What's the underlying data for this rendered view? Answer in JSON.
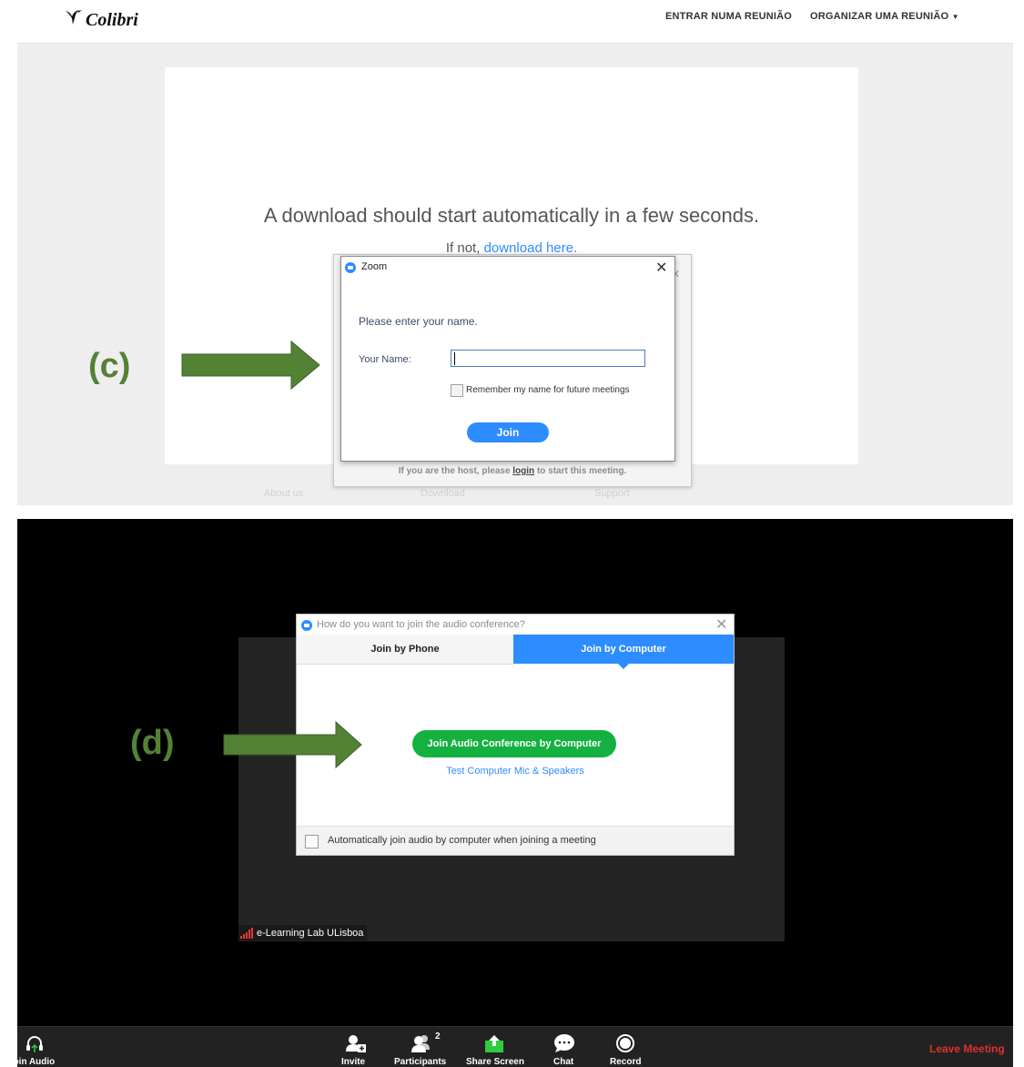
{
  "panel_c": {
    "brand": "Colibri",
    "nav": {
      "join": "ENTRAR NUMA REUNIÃO",
      "host": "ORGANIZAR UMA REUNIÃO"
    },
    "download_message": "A download should start automatically in a few seconds.",
    "download_prefix": "If not, ",
    "download_link": "download here.",
    "host_text_before": "If you are the host, please ",
    "host_login": "login",
    "host_text_after": " to start this meeting.",
    "footer": [
      "About us",
      "Download",
      "Support"
    ],
    "zoom_dialog": {
      "title": "Zoom",
      "prompt": "Please enter your name.",
      "name_label": "Your Name:",
      "name_value": "",
      "remember_label": "Remember my name for future meetings",
      "remember_checked": false,
      "join_button": "Join"
    },
    "callout_label": "(c)"
  },
  "panel_d": {
    "audio_dialog": {
      "title": "How do you want to join the audio conference?",
      "tabs": [
        "Join by Phone",
        "Join by Computer"
      ],
      "active_tab": "Join by Computer",
      "primary_button": "Join Audio Conference by Computer",
      "test_link": "Test Computer Mic & Speakers",
      "auto_join_label": "Automatically join audio by computer when joining a meeting",
      "auto_join_checked": false
    },
    "speaker_name": "e-Learning Lab ULisboa",
    "toolbar": {
      "join_audio": "Join Audio",
      "invite": "Invite",
      "participants": "Participants",
      "participant_count": "2",
      "share_screen": "Share Screen",
      "chat": "Chat",
      "record": "Record",
      "leave": "Leave Meeting"
    },
    "callout_label": "(d)"
  },
  "colors": {
    "zoom_blue": "#2d8cff",
    "join_green": "#15b140",
    "arrow_green": "#548235",
    "leave_red": "#e0302f"
  }
}
